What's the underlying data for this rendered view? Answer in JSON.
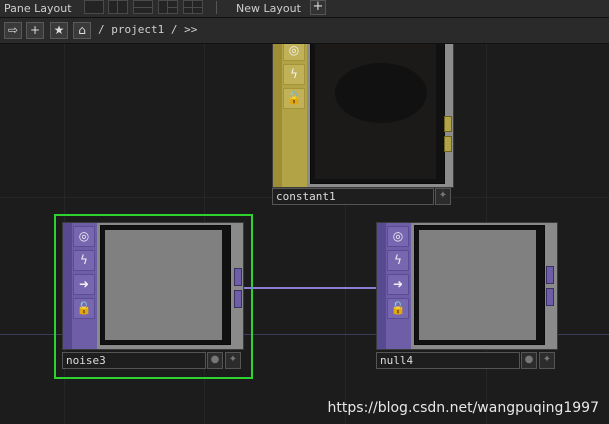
{
  "topbar": {
    "pane_layout_label": "Pane Layout",
    "new_layout_label": "New Layout",
    "new_layout_add": "+"
  },
  "pathbar": {
    "back_icon": "arrow-right-icon",
    "add_label": "+",
    "star_icon": "star-icon",
    "home_icon": "home-icon",
    "path": "/ project1 / >>"
  },
  "nodes": {
    "constant1": {
      "name": "constant1",
      "family_color": "#b3a347"
    },
    "noise3": {
      "name": "noise3",
      "family_color": "#6d5ea7",
      "selected": true
    },
    "null4": {
      "name": "null4",
      "family_color": "#6d5ea7"
    }
  },
  "icons": {
    "viewer": "◎",
    "cook": "ϟ",
    "export": "➜",
    "lock": "🔓"
  },
  "watermark": "https://blog.csdn.net/wangpuqing1997",
  "colors": {
    "selection": "#2ed22e",
    "wire": "#8a7fd6",
    "top_family": "#6d5ea7",
    "chop_family": "#b3a347"
  }
}
